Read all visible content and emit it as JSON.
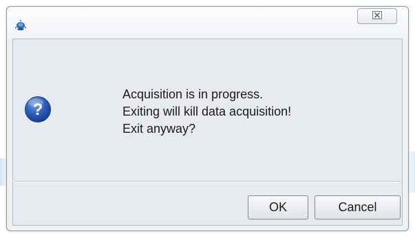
{
  "dialog": {
    "title": "",
    "close_symbol": "☒",
    "app_icon": "java-duke-icon",
    "question_icon": "question-mark-icon",
    "message_lines": [
      "Acquisition is in progress.",
      "Exiting will kill data acquisition!",
      "Exit anyway?"
    ],
    "buttons": {
      "ok_label": "OK",
      "cancel_label": "Cancel"
    }
  }
}
